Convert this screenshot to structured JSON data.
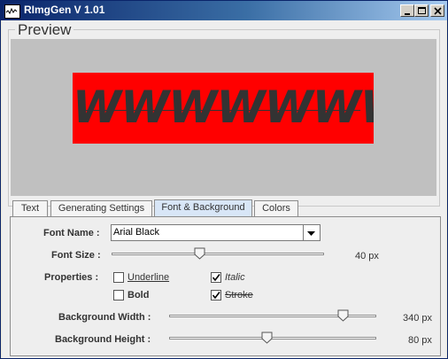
{
  "window": {
    "title": "RImgGen V 1.01"
  },
  "preview": {
    "legend": "Preview",
    "banner_text": "WWWWWWW",
    "banner_bg": "#ff0000",
    "text_color": "#333333",
    "area_bg": "#c0c0c0"
  },
  "tabs": [
    {
      "label": "Text",
      "active": false
    },
    {
      "label": "Generating Settings",
      "active": false
    },
    {
      "label": "Font & Background",
      "active": true
    },
    {
      "label": "Colors",
      "active": false
    }
  ],
  "font_name": {
    "label": "Font Name :",
    "value": "Arial Black"
  },
  "font_size": {
    "label": "Font Size :",
    "value": "40 px",
    "level": 0.41
  },
  "properties": {
    "label": "Properties :",
    "underline": {
      "label": "Underline",
      "checked": false
    },
    "italic": {
      "label": "Italic",
      "checked": true
    },
    "bold": {
      "label": "Bold",
      "checked": false
    },
    "stroke": {
      "label": "Stroke",
      "checked": true
    }
  },
  "bg_width": {
    "label": "Background Width :",
    "value": "340 px",
    "level": 0.86
  },
  "bg_height": {
    "label": "Background Height :",
    "value": "80 px",
    "level": 0.47
  }
}
